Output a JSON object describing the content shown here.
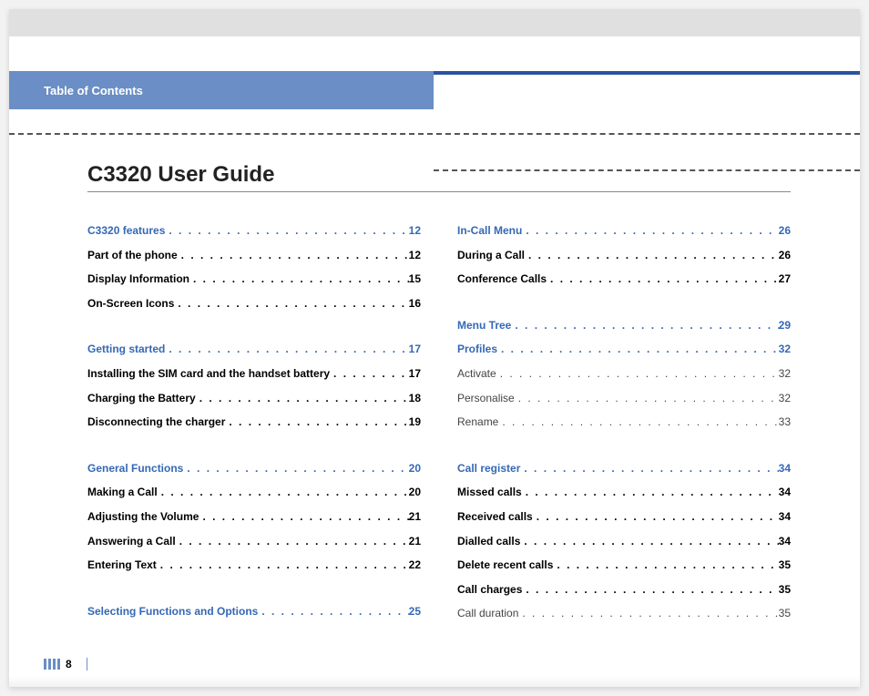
{
  "header": {
    "section_label": "Table of Contents",
    "title": "C3320 User Guide"
  },
  "footer": {
    "page_number": "8"
  },
  "toc": {
    "left": [
      {
        "label": "C3320 features",
        "page": "12",
        "style": "heading",
        "gap": false
      },
      {
        "label": "Part of the phone",
        "page": "12",
        "style": "bold",
        "gap": false
      },
      {
        "label": "Display Information",
        "page": "15",
        "style": "bold",
        "gap": false
      },
      {
        "label": "On-Screen Icons",
        "page": "16",
        "style": "bold",
        "gap": false
      },
      {
        "label": "Getting started",
        "page": "17",
        "style": "heading",
        "gap": true
      },
      {
        "label": "Installing the SIM card and the handset battery",
        "page": "17",
        "style": "bold",
        "gap": false
      },
      {
        "label": "Charging the Battery",
        "page": "18",
        "style": "bold",
        "gap": false
      },
      {
        "label": "Disconnecting the charger",
        "page": "19",
        "style": "bold",
        "gap": false
      },
      {
        "label": "General Functions",
        "page": "20",
        "style": "heading",
        "gap": true
      },
      {
        "label": "Making a Call",
        "page": "20",
        "style": "bold",
        "gap": false
      },
      {
        "label": "Adjusting the Volume",
        "page": "21",
        "style": "bold",
        "gap": false
      },
      {
        "label": "Answering a Call",
        "page": "21",
        "style": "bold",
        "gap": false
      },
      {
        "label": "Entering Text",
        "page": "22",
        "style": "bold",
        "gap": false
      },
      {
        "label": "Selecting Functions and Options",
        "page": "25",
        "style": "heading",
        "gap": true
      }
    ],
    "right": [
      {
        "label": "In-Call Menu",
        "page": "26",
        "style": "heading",
        "gap": false
      },
      {
        "label": "During a Call",
        "page": "26",
        "style": "bold",
        "gap": false
      },
      {
        "label": "Conference Calls",
        "page": "27",
        "style": "bold",
        "gap": false
      },
      {
        "label": "Menu Tree",
        "page": "29",
        "style": "heading",
        "gap": true
      },
      {
        "label": "Profiles",
        "page": "32",
        "style": "heading",
        "gap": false
      },
      {
        "label": "Activate",
        "page": "32",
        "style": "plain",
        "gap": false
      },
      {
        "label": "Personalise",
        "page": "32",
        "style": "plain",
        "gap": false
      },
      {
        "label": "Rename",
        "page": "33",
        "style": "plain",
        "gap": false
      },
      {
        "label": "Call register",
        "page": "34",
        "style": "heading",
        "gap": true
      },
      {
        "label": "Missed calls",
        "page": "34",
        "style": "bold",
        "gap": false
      },
      {
        "label": "Received calls",
        "page": "34",
        "style": "bold",
        "gap": false
      },
      {
        "label": "Dialled calls",
        "page": "34",
        "style": "bold",
        "gap": false
      },
      {
        "label": "Delete recent calls",
        "page": "35",
        "style": "bold",
        "gap": false
      },
      {
        "label": "Call charges",
        "page": "35",
        "style": "bold",
        "gap": false
      },
      {
        "label": "Call duration",
        "page": "35",
        "style": "plain",
        "gap": false
      }
    ]
  }
}
